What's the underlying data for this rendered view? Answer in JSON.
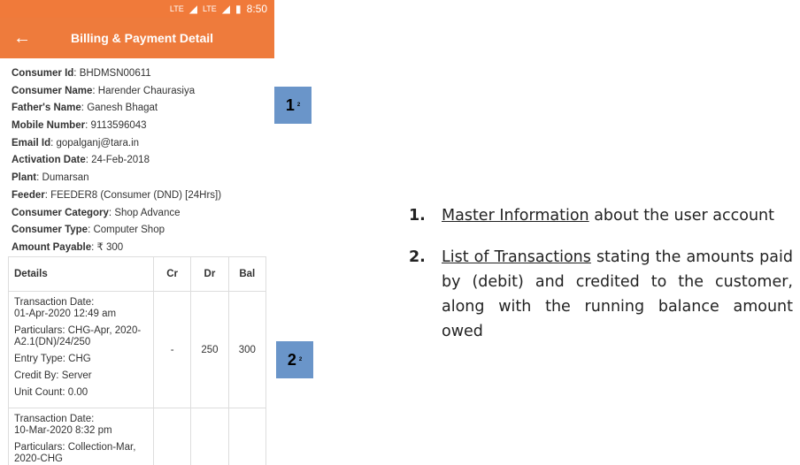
{
  "status_bar": {
    "signal1": "LTE",
    "signal2": "LTE",
    "time": "8:50"
  },
  "app_bar": {
    "title": "Billing & Payment Detail"
  },
  "info": [
    {
      "label": "Consumer Id",
      "value": "BHDMSN00611"
    },
    {
      "label": "Consumer Name",
      "value": "Harender Chaurasiya"
    },
    {
      "label": "Father's Name",
      "value": "Ganesh Bhagat"
    },
    {
      "label": "Mobile Number",
      "value": "9113596043"
    },
    {
      "label": "Email Id",
      "value": "gopalganj@tara.in"
    },
    {
      "label": "Activation Date",
      "value": "24-Feb-2018"
    },
    {
      "label": "Plant",
      "value": "Dumarsan"
    },
    {
      "label": "Feeder",
      "value": "FEEDER8 (Consumer (DND) [24Hrs])"
    },
    {
      "label": "Consumer Category",
      "value": "Shop Advance"
    },
    {
      "label": "Consumer Type",
      "value": "Computer Shop"
    },
    {
      "label": "Amount Payable",
      "value": "₹ 300"
    }
  ],
  "table": {
    "headers": {
      "details": "Details",
      "cr": "Cr",
      "dr": "Dr",
      "bal": "Bal"
    },
    "rows": [
      {
        "transaction_date_label": "Transaction Date:",
        "transaction_date": "01-Apr-2020 12:49 am",
        "particulars_label": "Particulars:",
        "particulars": "CHG-Apr, 2020-A2.1(DN)/24/250",
        "entry_type_label": "Entry Type:",
        "entry_type": "CHG",
        "credit_by_label": "Credit By:",
        "credit_by": "Server",
        "unit_count_label": "Unit Count:",
        "unit_count": "0.00",
        "cr": "-",
        "dr": "250",
        "bal": "300"
      },
      {
        "transaction_date_label": "Transaction Date:",
        "transaction_date": "10-Mar-2020 8:32 pm",
        "particulars_label": "Particulars:",
        "particulars": "Collection-Mar, 2020-CHG"
      }
    ]
  },
  "badges": [
    {
      "num": "1",
      "sup": "2"
    },
    {
      "num": "2",
      "sup": "2"
    }
  ],
  "legend": [
    {
      "num": "1.",
      "link": "Master Information",
      "text": " about the user account"
    },
    {
      "num": "2.",
      "link": "List of Transactions",
      "text": " stating the amounts paid by (debit) and credited to the customer, along with the running balance amount owed"
    }
  ]
}
